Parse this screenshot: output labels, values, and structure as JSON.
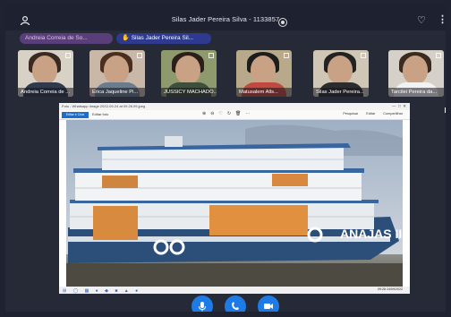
{
  "header": {
    "title": "Silas Jader Pereira Silva - 1133857"
  },
  "pinned": [
    {
      "name": "Andreia Correia de So..."
    },
    {
      "name": "Silas Jader Pereira Sil..."
    }
  ],
  "participants": [
    {
      "name": "Andreia Correia de ...",
      "bg": "#d8d2c6",
      "hair": "#3b2a22",
      "body": "#2f3b4c"
    },
    {
      "name": "Erica Jaqueline Pi...",
      "bg": "#c9b7a8",
      "hair": "#4a2e20",
      "body": "#6b7c8f"
    },
    {
      "name": "JUSSICY MACHADO...",
      "bg": "#8e9a6d",
      "hair": "#2a1f1a",
      "body": "#3e4f3a"
    },
    {
      "name": "Matusalem Alls...",
      "bg": "#b9a98b",
      "hair": "#1d1d1d",
      "body": "#c04a3f"
    },
    {
      "name": "Silas Jader Pereira...",
      "bg": "#cfc6b6",
      "hair": "#222222",
      "body": "#2c2c2c"
    },
    {
      "name": "Tarcilei Pereira da...",
      "bg": "#d6d1c8",
      "hair": "#3a2a20",
      "body": "#f2f2f2"
    }
  ],
  "share": {
    "window_title": "Foto - Whatsapp Image 2022-09-24 at 09.26.09.jpeg",
    "edit_button": "Editar e Criar",
    "edit_label": "Editar foto",
    "right_tools": "Pesquisar Editar Compartilhar",
    "clock": "09:28 24/09/2022"
  },
  "boat_name": "ANAJAS III"
}
